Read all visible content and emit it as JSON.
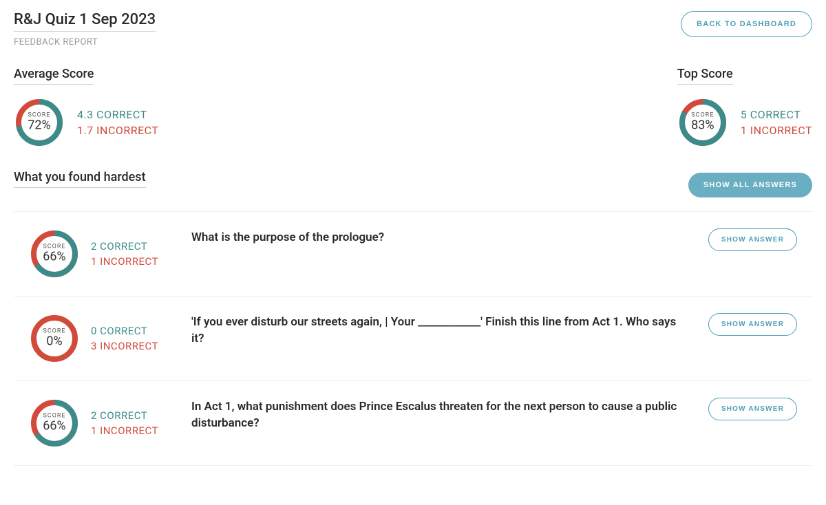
{
  "header": {
    "title": "R&J Quiz 1 Sep 2023",
    "subtitle": "FEEDBACK REPORT",
    "back_button": "BACK TO DASHBOARD"
  },
  "labels": {
    "score_word": "SCORE",
    "correct_suffix": " CORRECT",
    "incorrect_suffix": " INCORRECT",
    "show_answer": "SHOW ANSWER",
    "show_all": "SHOW ALL ANSWERS"
  },
  "average": {
    "heading": "Average Score",
    "percent": "72%",
    "correct": "4.3",
    "incorrect": "1.7",
    "donut_pct": 72
  },
  "top": {
    "heading": "Top Score",
    "percent": "83%",
    "correct": "5",
    "incorrect": "1",
    "donut_pct": 83
  },
  "hardest": {
    "heading": "What you found hardest"
  },
  "questions": [
    {
      "percent": "66%",
      "correct": "2",
      "incorrect": "1",
      "donut_pct": 66,
      "text": "What is the purpose of the prologue?"
    },
    {
      "percent": "0%",
      "correct": "0",
      "incorrect": "3",
      "donut_pct": 0,
      "text": "'If you ever disturb our streets again, | Your ____________' Finish this line from Act 1. Who says it?"
    },
    {
      "percent": "66%",
      "correct": "2",
      "incorrect": "1",
      "donut_pct": 66,
      "text": "In Act 1, what punishment does Prince Escalus threaten for the next person to cause a public disturbance?"
    }
  ],
  "colors": {
    "teal": "#3d8a8a",
    "red": "#d24a3a",
    "btn_teal": "#4a9eb8"
  }
}
